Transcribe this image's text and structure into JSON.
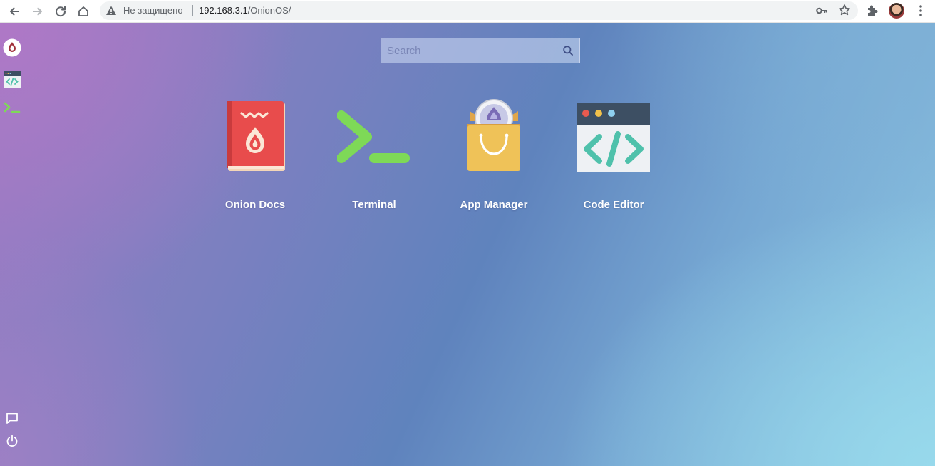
{
  "browser": {
    "security_label": "Не защищено",
    "url_host": "192.168.3.1",
    "url_path": "/OnionOS/",
    "icons": [
      "back-arrow-icon",
      "forward-arrow-icon",
      "reload-icon",
      "home-icon",
      "warning-icon",
      "key-icon",
      "star-icon",
      "puzzle-icon",
      "kebab-menu-icon"
    ]
  },
  "search": {
    "placeholder": "Search",
    "icon": "search-icon"
  },
  "sidebar": {
    "items": [
      {
        "icon": "onion-logo-icon"
      },
      {
        "icon": "code-editor-icon"
      },
      {
        "icon": "terminal-icon"
      }
    ],
    "bottom_items": [
      {
        "icon": "chat-icon"
      },
      {
        "icon": "power-icon"
      }
    ]
  },
  "apps": [
    {
      "label": "Onion Docs",
      "icon": "onion-docs-icon"
    },
    {
      "label": "Terminal",
      "icon": "terminal-icon"
    },
    {
      "label": "App Manager",
      "icon": "app-manager-icon"
    },
    {
      "label": "Code Editor",
      "icon": "code-editor-icon"
    }
  ],
  "colors": {
    "terminal_green": "#7ed957",
    "docs_red": "#e84c4c",
    "bag_yellow": "#efc258",
    "editor_header": "#3d4f63",
    "editor_code": "#4fc1ab"
  }
}
